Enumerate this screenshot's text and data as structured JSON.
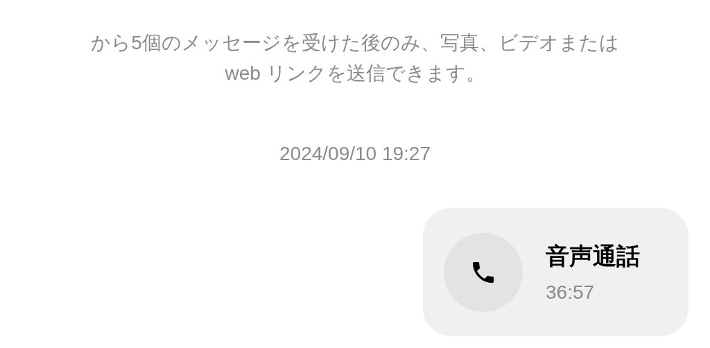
{
  "notice": "から5個のメッセージを受けた後のみ、写真、ビデオまたは web リンクを送信できます。",
  "timestamp": "2024/09/10 19:27",
  "call_message": {
    "title": "音声通話",
    "duration": "36:57"
  }
}
